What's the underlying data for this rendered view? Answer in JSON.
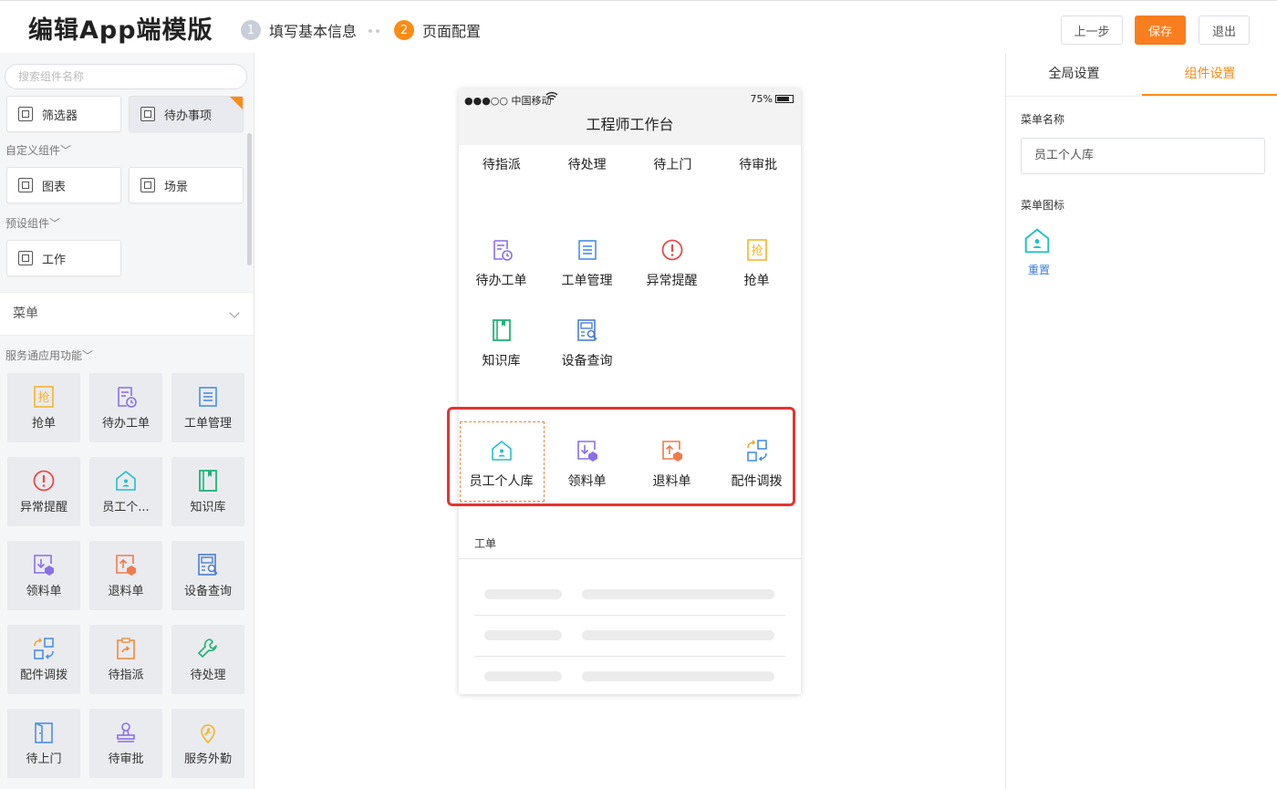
{
  "header": {
    "title": "编辑App端模版",
    "steps": [
      {
        "num": "1",
        "label": "填写基本信息"
      },
      {
        "num": "2",
        "label": "页面配置"
      }
    ],
    "buttons": {
      "prev": "上一步",
      "save": "保存",
      "exit": "退出"
    },
    "accent_color": "#fa7d1e"
  },
  "left": {
    "search_placeholder": "搜索组件名称",
    "components_top": [
      "筛选器",
      "待办事项"
    ],
    "group_custom": "自定义组件",
    "components_custom": [
      "图表",
      "场景"
    ],
    "group_preset": "预设组件",
    "components_preset": [
      "工作"
    ],
    "menu_label": "菜单",
    "group_service": "服务通应用功能",
    "tiles": [
      {
        "label": "抢单",
        "icon": "grab-order-icon"
      },
      {
        "label": "待办工单",
        "icon": "pending-order-icon"
      },
      {
        "label": "工单管理",
        "icon": "order-manage-icon"
      },
      {
        "label": "异常提醒",
        "icon": "alert-icon"
      },
      {
        "label": "员工个...",
        "icon": "staff-store-icon"
      },
      {
        "label": "知识库",
        "icon": "knowledge-icon"
      },
      {
        "label": "领料单",
        "icon": "material-receive-icon"
      },
      {
        "label": "退料单",
        "icon": "material-return-icon"
      },
      {
        "label": "设备查询",
        "icon": "device-search-icon"
      },
      {
        "label": "配件调拨",
        "icon": "parts-transfer-icon"
      },
      {
        "label": "待指派",
        "icon": "to-assign-icon"
      },
      {
        "label": "待处理",
        "icon": "to-handle-icon"
      },
      {
        "label": "待上门",
        "icon": "to-visit-icon"
      },
      {
        "label": "待审批",
        "icon": "to-approve-icon"
      },
      {
        "label": "服务外勤",
        "icon": "field-service-icon"
      }
    ]
  },
  "phone": {
    "carrier": "●●●○○ 中国移动",
    "battery": "75%",
    "title": "工程师工作台",
    "tabs": [
      "待指派",
      "待处理",
      "待上门",
      "待审批"
    ],
    "grid1": [
      "待办工单",
      "工单管理",
      "异常提醒",
      "抢单",
      "知识库",
      "设备查询"
    ],
    "grid2": [
      "员工个人库",
      "领料单",
      "退料单",
      "配件调拨"
    ],
    "section_title": "工单"
  },
  "right": {
    "tabs": [
      "全局设置",
      "组件设置"
    ],
    "menu_name_label": "菜单名称",
    "menu_name_value": "员工个人库",
    "menu_icon_label": "菜单图标",
    "reset_label": "重置"
  }
}
